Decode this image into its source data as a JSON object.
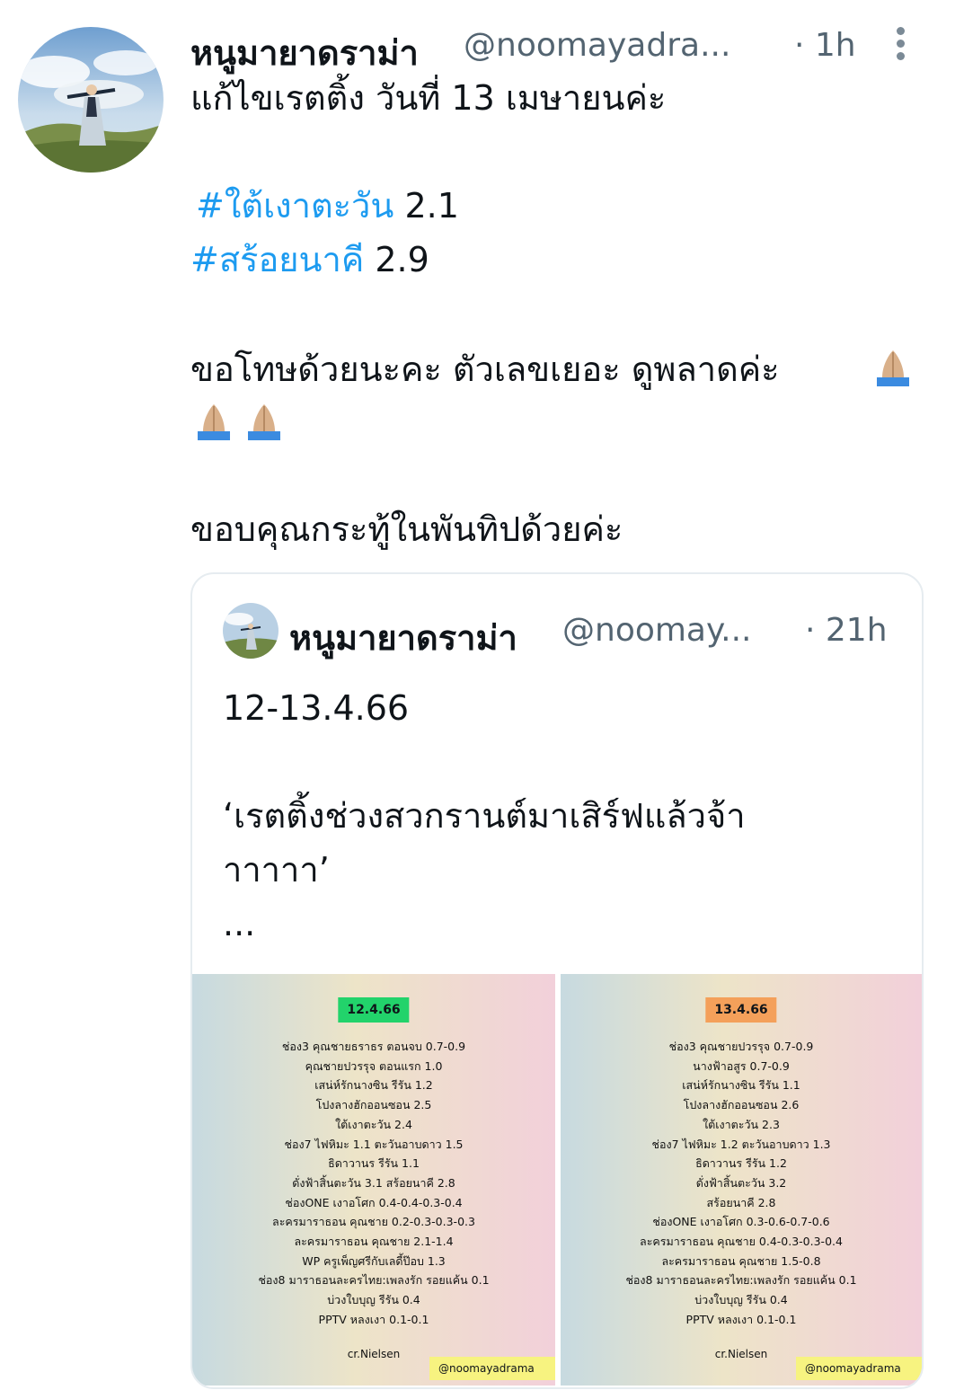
{
  "tweet": {
    "author_name": "หนูมายาดราม่า",
    "handle": "@noomayadra...",
    "time": "· 1h",
    "lines": {
      "line1": "แก้ไขเรตติ้ง วันที่ 13 เมษายนค่ะ",
      "hashtag1": "#ใต้เงาตะวัน",
      "value1": " 2.1",
      "hashtag2": "#สร้อยนาคี",
      "value2": " 2.9",
      "apology": "ขอโทษด้วยนะคะ ตัวเลขเยอะ ดูพลาดค่ะ",
      "thanks": "ขอบคุณกระทู้ในพันทิปด้วยค่ะ"
    }
  },
  "quote": {
    "author_name": "หนูมายาดราม่า",
    "handle": "@noomay...",
    "time": "· 21h",
    "date_line": "12-13.4.66",
    "text_line1": "‘เรตติ้งช่วงสวกรานต์มาเสิร์ฟแล้วจ้า",
    "text_line2": "าาาาา’",
    "ellipsis": "...",
    "images": [
      {
        "date": "12.4.66",
        "date_color": "#22d36b",
        "rows": [
          "ช่อง3  คุณชายธราธร ตอนจบ 0.7-0.9",
          "คุณชายปวรรุจ ตอนแรก 1.0",
          "เสน่ห์รักนางซิน รีรัน 1.2",
          "โปงลางฮักออนซอน 2.5",
          "ใต้เงาตะวัน  2.4",
          "ช่อง7  ไฟหิมะ 1.1  ตะวันอาบดาว 1.5",
          "ธิดาวานร รีรัน 1.1",
          "ดั่งฟ้าสิ้นตะวัน 3.1  สร้อยนาคี 2.8",
          "ช่องONE เงาอโศก 0.4-0.4-0.3-0.4",
          "ละครมาราธอน คุณชาย 0.2-0.3-0.3-0.3",
          "ละครมาราธอน คุณชาย  2.1-1.4",
          "WP  ครูเพ็ญศรีกับเลดี้ป๊อบ 1.3",
          "ช่อง8   มาราธอนละครไทย:เพลงรัก รอยแค้น  0.1",
          "บ่วงใบบุญ รีรัน 0.4",
          "PPTV   หลงเงา 0.1-0.1"
        ],
        "credit": "cr.Nielsen",
        "watermark": "@noomayadrama"
      },
      {
        "date": "13.4.66",
        "date_color": "#f4a05a",
        "rows": [
          "ช่อง3  คุณชายปวรรุจ 0.7-0.9",
          "นางฟ้าอสูร 0.7-0.9",
          "เสน่ห์รักนางซิน รีรัน  1.1",
          "โปงลางฮักออนซอน 2.6",
          "ใต้เงาตะวัน 2.3",
          "ช่อง7  ไฟหิมะ 1.2  ตะวันอาบดาว 1.3",
          "ธิดาวานร รีรัน 1.2",
          "ดั่งฟ้าสิ้นตะวัน 3.2",
          "สร้อยนาคี 2.8",
          "ช่องONE เงาอโศก 0.3-0.6-0.7-0.6",
          "ละครมาราธอน คุณชาย 0.4-0.3-0.3-0.4",
          "ละครมาราธอน คุณชาย 1.5-0.8",
          "ช่อง8   มาราธอนละครไทย:เพลงรัก รอยแค้น 0.1",
          "บ่วงใบบุญ รีรัน 0.4",
          "PPTV   หลงเงา 0.1-0.1"
        ],
        "credit": "cr.Nielsen",
        "watermark": "@noomayadrama"
      }
    ]
  },
  "icons": {
    "more": "more-vertical-icon",
    "emoji": "folded-hands-emoji"
  }
}
